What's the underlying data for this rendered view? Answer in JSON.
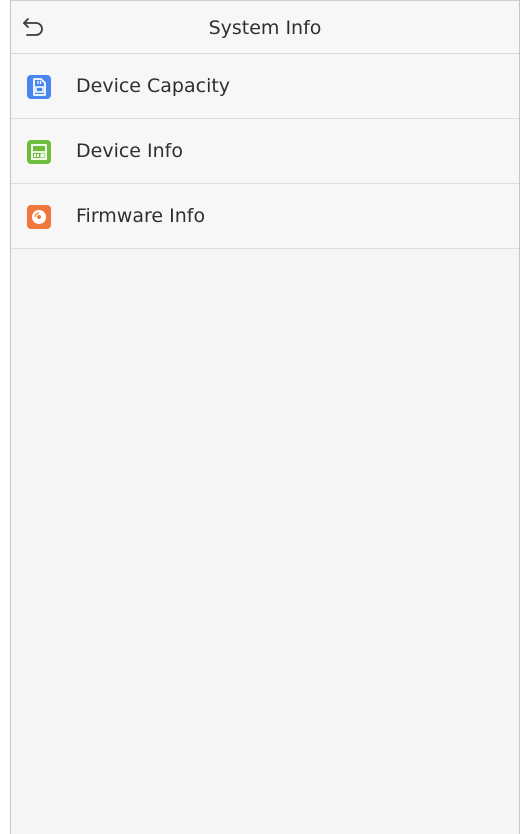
{
  "header": {
    "title": "System Info",
    "back_icon": "back-arrow-icon"
  },
  "menu": {
    "items": [
      {
        "label": "Device Capacity",
        "icon": "sd-card-icon",
        "color": "#4a86f0"
      },
      {
        "label": "Device Info",
        "icon": "device-panel-icon",
        "color": "#6fbd3a"
      },
      {
        "label": "Firmware Info",
        "icon": "disc-icon",
        "color": "#f0783c"
      }
    ]
  },
  "colors": {
    "background": "#f5f5f5",
    "header_background": "#f7f7f7",
    "divider": "#dddddd",
    "text": "#2f2f2f"
  }
}
